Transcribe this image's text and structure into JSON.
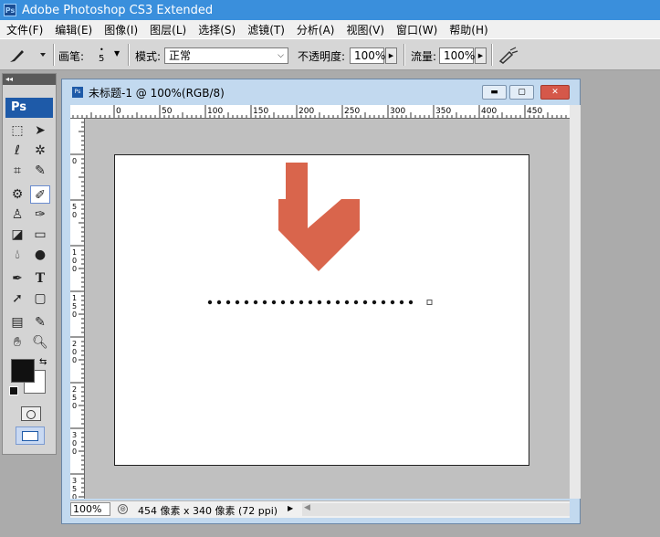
{
  "app": {
    "title": "Adobe Photoshop CS3 Extended",
    "icon": "ps-app-icon",
    "logo_text": "Ps"
  },
  "menu": [
    "文件(F)",
    "编辑(E)",
    "图像(I)",
    "图层(L)",
    "选择(S)",
    "滤镜(T)",
    "分析(A)",
    "视图(V)",
    "窗口(W)",
    "帮助(H)"
  ],
  "options": {
    "brush_label": "画笔:",
    "brush_size": "5",
    "mode_label": "模式:",
    "mode_value": "正常",
    "opacity_label": "不透明度:",
    "opacity_value": "100%",
    "flow_label": "流量:",
    "flow_value": "100%"
  },
  "toolbox": {
    "header": "◂◂",
    "badge": "Ps",
    "tools": [
      "rectangular-marquee-icon",
      "move-icon",
      "lasso-icon",
      "magic-wand-icon",
      "crop-icon",
      "slice-icon",
      "healing-brush-icon",
      "brush-icon",
      "clone-stamp-icon",
      "history-brush-icon",
      "eraser-icon",
      "gradient-icon",
      "blur-icon",
      "dodge-icon",
      "pen-icon",
      "type-icon",
      "path-selection-icon",
      "shape-icon",
      "notes-icon",
      "eyedropper-icon",
      "hand-icon",
      "zoom-icon"
    ],
    "active_tool": "brush-icon",
    "foreground_color": "#111111",
    "background_color": "#ffffff"
  },
  "document": {
    "title": "未标题-1 @ 100%(RGB/8)",
    "ruler_top_labels": [
      "0",
      "50",
      "100",
      "150",
      "200",
      "250",
      "300",
      "350",
      "400",
      "450"
    ],
    "ruler_left_labels": [
      "0",
      "5\n0",
      "1\n0\n0",
      "1\n5\n0",
      "2\n0\n0",
      "2\n5\n0",
      "3\n0\n0",
      "3\n5\n0"
    ],
    "canvas": {
      "arrow_color": "#d9654c",
      "dot_count": 23,
      "dot_color": "#111111"
    },
    "status": {
      "zoom": "100%",
      "info": "454 像素 x 340 像素 (72 ppi)"
    }
  }
}
